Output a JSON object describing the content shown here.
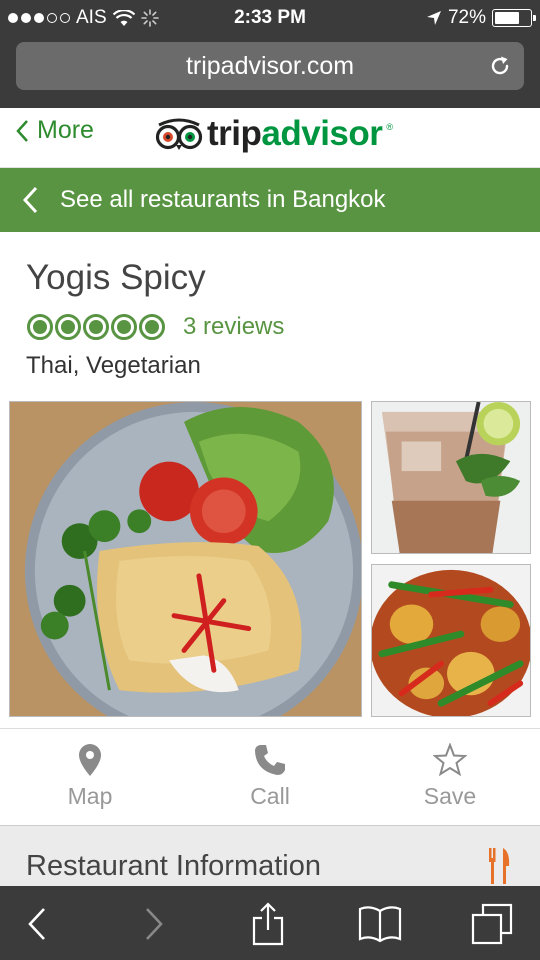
{
  "status": {
    "carrier": "AIS",
    "time": "2:33 PM",
    "battery": "72%",
    "battery_level": 0.72
  },
  "browser": {
    "url": "tripadvisor.com"
  },
  "header": {
    "more_label": "More",
    "logo_trip": "trip",
    "logo_advisor": "advisor"
  },
  "banner": {
    "label": "See all restaurants in Bangkok"
  },
  "restaurant": {
    "name": "Yogis Spicy",
    "rating": 5,
    "reviews": "3 reviews",
    "cuisine": "Thai, Vegetarian"
  },
  "actions": {
    "map": "Map",
    "call": "Call",
    "save": "Save"
  },
  "info": {
    "title": "Restaurant Information"
  },
  "colors": {
    "brand_green": "#589442",
    "toolbar_bg": "#3b3b3b",
    "accent_orange": "#e8712a"
  }
}
